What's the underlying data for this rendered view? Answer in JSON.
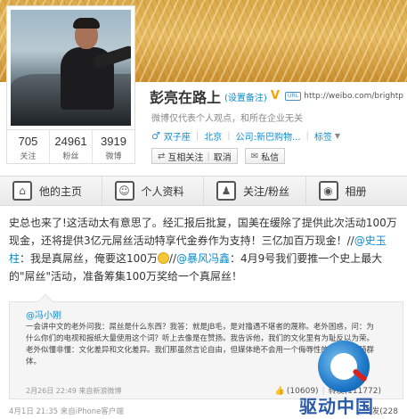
{
  "profile": {
    "name": "彭亮在路上",
    "remark": "(设置备注)",
    "url_icon_text": "URL",
    "url": "http://weibo.com/brightp",
    "description": "微博仅代表个人观点，和所在企业无关",
    "gender_icon": "male-icon",
    "tags": [
      "双子座",
      "北京",
      "公司:新巴购物..."
    ],
    "tags_more": "标签",
    "stats": [
      {
        "value": "705",
        "label": "关注"
      },
      {
        "value": "24961",
        "label": "粉丝"
      },
      {
        "value": "3919",
        "label": "微博"
      }
    ],
    "follow_button": {
      "icon": "mutual-follow-icon",
      "label": "互相关注",
      "cancel": "取消"
    },
    "message_button": {
      "icon": "mail-icon",
      "label": "私信"
    }
  },
  "nav": {
    "items": [
      {
        "icon": "home-icon",
        "label": "他的主页"
      },
      {
        "icon": "profile-icon",
        "label": "个人资料"
      },
      {
        "icon": "follow-fans-icon",
        "label": "关注/粉丝"
      },
      {
        "icon": "camera-icon",
        "label": "相册"
      }
    ]
  },
  "post": {
    "text_1": "史总也来了!这活动太有意思了。经汇报后批复，国美在缓除了提供此次活动100万现金，还将提供3亿元屌丝活动特享代金券作为支持！三亿加百万现金！//",
    "mention_1": "@史玉柱",
    "text_2": "：我是真屌丝，俺要这100万",
    "text_3": "//",
    "mention_2": "@暴风冯鑫",
    "text_4": "：4月9号我们要推一个史上最大的\"屌丝\"活动，准备筹集100万奖给一个真屌丝！",
    "emoji": "smile-emoji",
    "meta": "4月1日 21:35  来自iPhone客户端",
    "repost": "转发(228",
    "repost_sep": "|"
  },
  "retweet": {
    "author": "@冯小刚",
    "text": "一会讲中文的老外问我：屌丝是什么东西？我答：就是JB毛，是对撸遇不堪者的蔑称。老外困惑，问：为什么你们的电视和报纸大量使用这个词？听上去像是在赞扬。我告诉他，我们的文化里有为耻反以为荣。老外似懂非懂：文化差异和文化差异。我们那虽然言论自由，但媒体绝不会用一个侮辱性的词形容招骑群体。",
    "meta": "2月26日 22:49  来自新浪微博",
    "likes_icon": "thumb-up-icon",
    "likes": "(10609)",
    "repost": "转发(111772)"
  },
  "watermark": {
    "brand": "驱动中国"
  }
}
